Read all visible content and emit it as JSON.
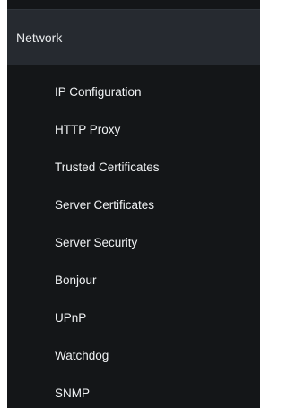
{
  "sidebar": {
    "section_title": "Network",
    "items": [
      {
        "label": "IP Configuration"
      },
      {
        "label": "HTTP Proxy"
      },
      {
        "label": "Trusted Certificates"
      },
      {
        "label": "Server Certificates"
      },
      {
        "label": "Server Security"
      },
      {
        "label": "Bonjour"
      },
      {
        "label": "UPnP"
      },
      {
        "label": "Watchdog"
      },
      {
        "label": "SNMP"
      }
    ]
  },
  "colors": {
    "panel_background": "#141618",
    "header_background": "#262a30",
    "text": "#f0f2f4"
  }
}
